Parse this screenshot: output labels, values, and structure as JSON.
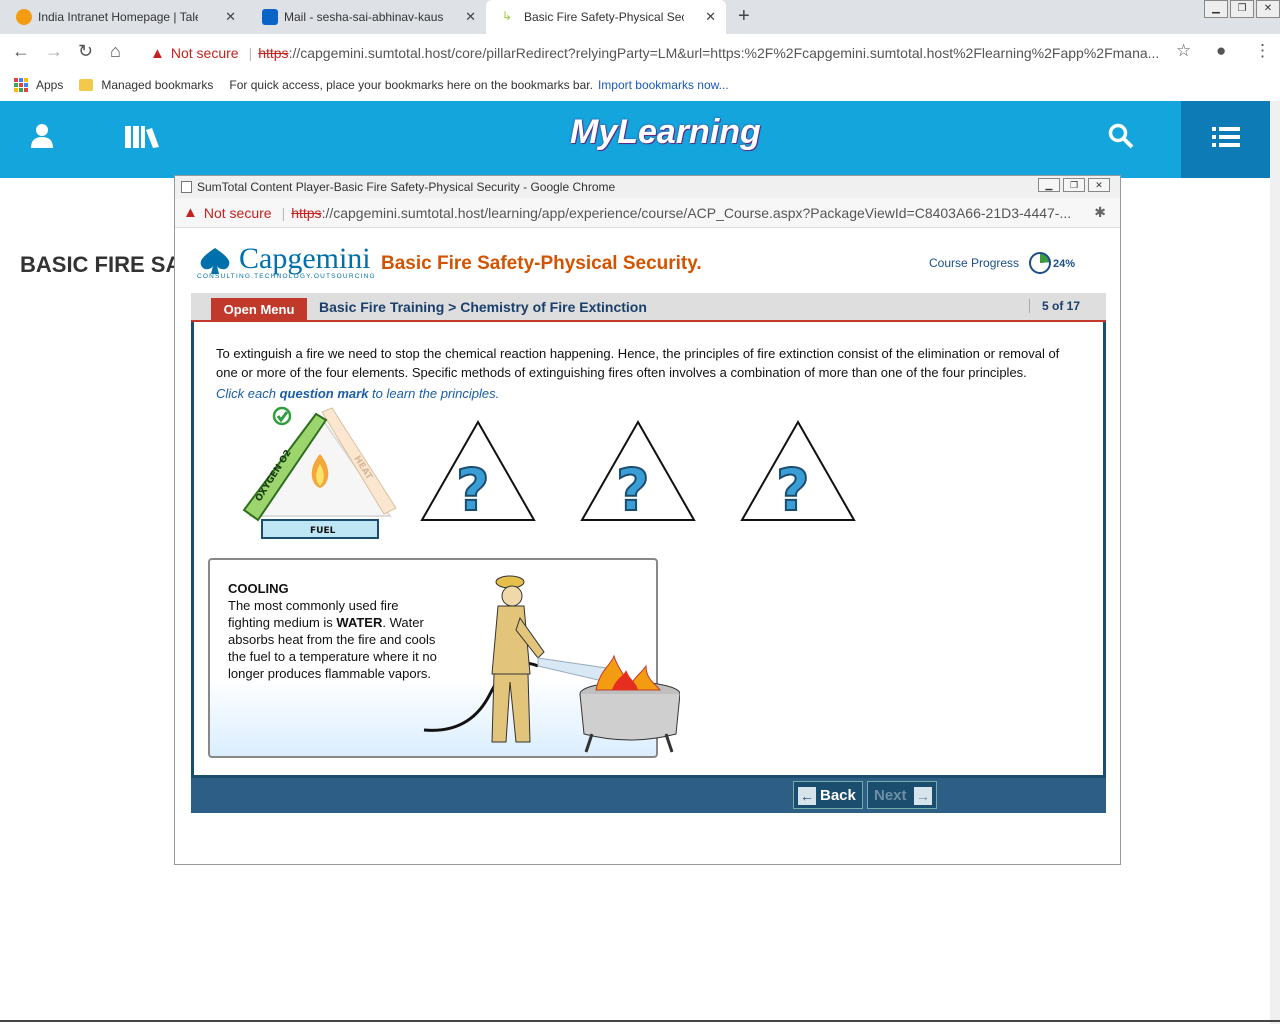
{
  "browser": {
    "tabs": [
      {
        "label": "India Intranet Homepage | Talent",
        "active": false
      },
      {
        "label": "Mail - sesha-sai-abhinav-kaushal",
        "active": false
      },
      {
        "label": "Basic Fire Safety-Physical Security",
        "active": true
      }
    ],
    "new_tab": "+",
    "not_secure": "Not secure",
    "url_scheme": "https",
    "url_rest": "://capgemini.sumtotal.host/core/pillarRedirect?relyingParty=LM&url=https:%2F%2Fcapgemini.sumtotal.host%2Flearning%2Fapp%2Fmana...",
    "bookmarks": {
      "apps": "Apps",
      "managed": "Managed bookmarks",
      "hint": "For quick access, place your bookmarks here on the bookmarks bar.",
      "import": "Import bookmarks now..."
    }
  },
  "app": {
    "logo": "MyLearning",
    "page_title_fragment": "BASIC FIRE SAI"
  },
  "popup": {
    "window_title": "SumTotal Content Player-Basic Fire Safety-Physical Security - Google Chrome",
    "not_secure": "Not secure",
    "url_scheme": "https",
    "url_rest": "://capgemini.sumtotal.host/learning/app/experience/course/ACP_Course.aspx?PackageViewId=C8403A66-21D3-4447-..."
  },
  "course": {
    "brand": "Capgemini",
    "brand_tagline": "CONSULTING.TECHNOLOGY.OUTSOURCING",
    "title": "Basic Fire Safety-Physical Security.",
    "progress_label": "Course Progress",
    "progress_value": "24%",
    "progress_fraction": 0.24,
    "open_menu": "Open Menu",
    "breadcrumb": "Basic Fire Training > Chemistry of Fire Extinction",
    "pager": "5 of 17",
    "paragraph": "To extinguish a fire we need to stop the chemical reaction happening. Hence, the principles of fire extinction consist of the elimination or removal of one or more of the four elements. Specific methods of extinguishing fires often involves a combination of more than one of the four principles.",
    "instruction_pre": "Click each ",
    "instruction_bold": "question mark",
    "instruction_post": " to learn the principles.",
    "triangle_labels": {
      "oxygen": "OXYGEN O2",
      "heat": "HEAT",
      "fuel": "FUEL"
    },
    "question_mark": "?",
    "callout": {
      "heading": "COOLING",
      "line1": "The most commonly used fire fighting medium is ",
      "bold": "WATER",
      "line2": ". Water absorbs heat from the fire and cools the fuel to a temperature where it no longer produces flammable vapors."
    },
    "back": "Back",
    "next": "Next"
  },
  "colors": {
    "mylearning_bar": "#13a5dc",
    "course_title": "#d35400",
    "open_menu": "#c0392b",
    "footer": "#2d5f86"
  }
}
